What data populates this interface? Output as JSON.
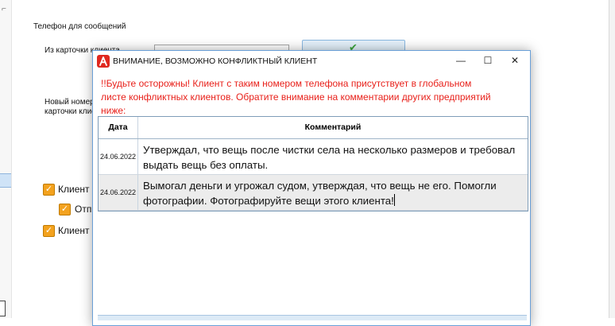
{
  "background": {
    "section_label": "Телефон для сообщений",
    "from_card_label": "Из карточки клиента",
    "new_number_label_line1": "Новый номер",
    "new_number_label_line2": "карточки клие",
    "checkbox_1_label": "Клиент с",
    "checkbox_2_label": "Отп",
    "checkbox_3_label": "Клиент с"
  },
  "dialog": {
    "title": "ВНИМАНИЕ, ВОЗМОЖНО КОНФЛИКТНЫЙ КЛИЕНТ",
    "warning": "!!Будьте осторожны! Клиент с таким номером телефона присутствует в глобальном листе конфликтных клиентов. Обратите внимание на комментарии других предприятий ниже:",
    "columns": {
      "date": "Дата",
      "comment": "Комментарий"
    },
    "rows": [
      {
        "date": "24.06.2022",
        "comment": "Утверждал, что вещь после чистки села на несколько размеров и требовал выдать вещь без оплаты."
      },
      {
        "date": "24.06.2022",
        "comment": "Вымогал деньги и угрожал судом, утверждая, что вещь не его. Помогли фотографии. Фотографируйте вещи этого клиента!"
      }
    ]
  },
  "colors": {
    "warning_text": "#e8201a",
    "checkbox_accent": "#f3a21e",
    "dialog_border": "#6aa0d8"
  },
  "icons": {
    "app": "app-logo-icon",
    "minimize": "minimize-icon",
    "maximize": "maximize-icon",
    "close": "close-icon",
    "confirm": "checkmark-icon"
  }
}
